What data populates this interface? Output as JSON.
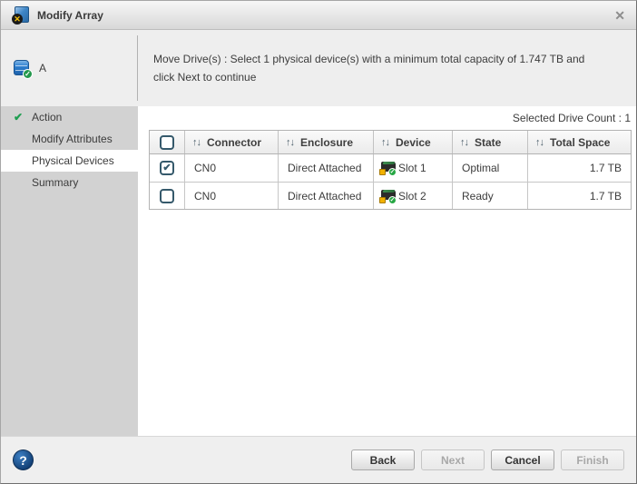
{
  "window": {
    "title": "Modify Array",
    "icons": {
      "close_glyph": "✕",
      "title_badge_glyph": "✕"
    }
  },
  "sidebar": {
    "array": {
      "label": "A",
      "icon": "disk-array-with-check",
      "badge_glyph": "✓"
    },
    "completed_glyph": "✔",
    "steps": [
      {
        "label": "Action",
        "status": "completed"
      },
      {
        "label": "Modify Attributes",
        "status": "pending"
      },
      {
        "label": "Physical Devices",
        "status": "active"
      },
      {
        "label": "Summary",
        "status": "pending"
      }
    ]
  },
  "main": {
    "instruction": "Move Drive(s) : Select 1 physical device(s) with a minimum total capacity of 1.747 TB and click Next to continue",
    "selected_count_label": "Selected Drive Count : 1",
    "table": {
      "sort_glyph": "↑↓",
      "header_check_glyph": "",
      "columns": [
        "Connector",
        "Enclosure",
        "Device",
        "State",
        "Total Space"
      ],
      "device_badge_glyph": "✓",
      "rows": [
        {
          "checked": true,
          "check_glyph": "✔",
          "connector": "CN0",
          "enclosure": "Direct Attached",
          "device": "Slot 1",
          "state": "Optimal",
          "total_space": "1.7 TB"
        },
        {
          "checked": false,
          "check_glyph": "",
          "connector": "CN0",
          "enclosure": "Direct Attached",
          "device": "Slot 2",
          "state": "Ready",
          "total_space": "1.7 TB"
        }
      ]
    }
  },
  "footer": {
    "help_glyph": "?",
    "buttons": [
      {
        "label": "Back",
        "enabled": true
      },
      {
        "label": "Next",
        "enabled": false
      },
      {
        "label": "Cancel",
        "enabled": true
      },
      {
        "label": "Finish",
        "enabled": false
      }
    ]
  },
  "colors": {
    "checkbox_accent": "#35596b",
    "done_green": "#1e9e50",
    "help_blue": "#123f74",
    "sidebar_gray": "#d2d2d2",
    "panel_gray": "#eeeeee"
  }
}
